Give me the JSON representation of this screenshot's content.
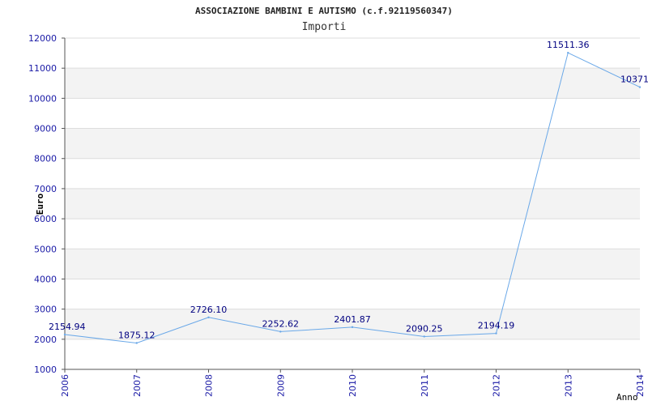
{
  "chart_data": {
    "type": "line",
    "title": "ASSOCIAZIONE BAMBINI E AUTISMO (c.f.92119560347)",
    "subtitle": "Importi",
    "xlabel": "Anno",
    "ylabel": "Euro",
    "categories": [
      "2006",
      "2007",
      "2008",
      "2009",
      "2010",
      "2011",
      "2012",
      "2013",
      "2014"
    ],
    "series": [
      {
        "values": [
          2154.94,
          1875.12,
          2726.1,
          2252.62,
          2401.87,
          2090.25,
          2194.19,
          11511.36,
          10371.0
        ],
        "labels": [
          "2154.94",
          "1875.12",
          "2726.10",
          "2252.62",
          "2401.87",
          "2090.25",
          "2194.19",
          "11511.36",
          "10371.0"
        ]
      }
    ],
    "yticks": [
      "1000",
      "2000",
      "3000",
      "4000",
      "5000",
      "6000",
      "7000",
      "8000",
      "9000",
      "10000",
      "11000",
      "12000"
    ],
    "ylim": [
      1000,
      12000
    ],
    "grid": true,
    "band_color": "#f3f3f3",
    "grid_color": "#dddddd",
    "line_color": "#6aa8e8",
    "tick_color": "#1a1aa6"
  }
}
